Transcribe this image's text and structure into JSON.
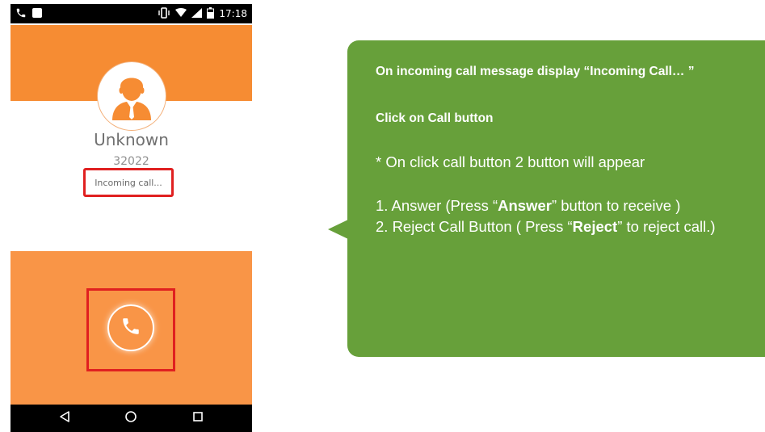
{
  "status_bar": {
    "time": "17:18",
    "icons": [
      "phone-icon",
      "notification-square-icon",
      "vibrate-icon",
      "wifi-icon",
      "signal-icon",
      "battery-icon"
    ]
  },
  "caller": {
    "name": "Unknown",
    "number": "32022",
    "status_text": "Incoming call..."
  },
  "call_button": {
    "icon": "phone-icon"
  },
  "nav_bar": {
    "buttons": [
      "back-icon",
      "home-icon",
      "recents-icon"
    ]
  },
  "callout": {
    "heading_1": "On incoming call message display “Incoming Call… ”",
    "heading_2": "Click on Call button",
    "note": "* On click call button 2 button will appear",
    "item_1_prefix": "1. Answer (Press “",
    "item_1_bold": "Answer",
    "item_1_suffix": "” button to receive )",
    "item_2_prefix": "2. Reject Call Button ( Press “",
    "item_2_bold": "Reject",
    "item_2_suffix": "” to reject call.)"
  },
  "colors": {
    "accent_orange": "#f68c33",
    "bottom_orange": "#f99547",
    "callout_green": "#67a03a",
    "highlight_red": "#e02020"
  }
}
